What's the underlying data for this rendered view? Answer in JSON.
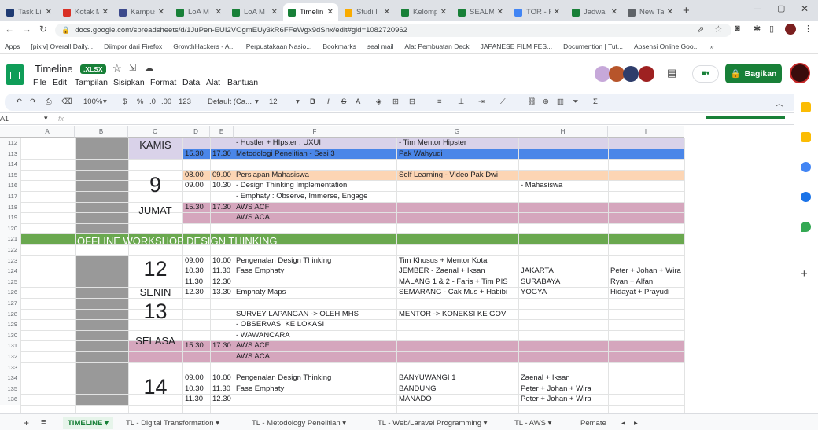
{
  "browser": {
    "tabs": [
      {
        "label": "Task Lis",
        "icon": "check-icon",
        "color": "#1f3b73"
      },
      {
        "label": "Kotak M",
        "icon": "gmail-icon",
        "color": "#d93025"
      },
      {
        "label": "Kampus",
        "icon": "doc-icon",
        "color": "#3c4a8c"
      },
      {
        "label": "LoA M",
        "icon": "drive-icon",
        "color": "#188038"
      },
      {
        "label": "LoA M",
        "icon": "sheets-icon",
        "color": "#188038"
      },
      {
        "label": "Timelin",
        "icon": "sheets-icon",
        "color": "#188038"
      },
      {
        "label": "Studi I",
        "icon": "drive-icon",
        "color": "#f9ab00"
      },
      {
        "label": "Kelomp",
        "icon": "sheets-icon",
        "color": "#188038"
      },
      {
        "label": "SEALM",
        "icon": "sheets-icon",
        "color": "#188038"
      },
      {
        "label": "TOR - F",
        "icon": "docs-icon",
        "color": "#4285f4"
      },
      {
        "label": "Jadwal",
        "icon": "sheets-icon",
        "color": "#188038"
      },
      {
        "label": "New Ta",
        "icon": "globe-icon",
        "color": "#5f6368"
      }
    ],
    "url": "docs.google.com/spreadsheets/d/1JuPen-EUI2VOgmEUy3kR6FFeWgx9dSnx/edit#gid=1082720962",
    "bookmarks": [
      "Apps",
      "[pixiv] Overall Daily...",
      "Diimpor dari Firefox",
      "GrowthHackers - A...",
      "Perpustakaan Nasio...",
      "Bookmarks",
      "seal mail",
      "Alat Pembuatan Deck",
      "JAPANESE FILM FES...",
      "Documention | Tut...",
      "Absensi Online Goo..."
    ]
  },
  "doc": {
    "title": "Timeline",
    "badge": ".XLSX",
    "share": "Bagikan",
    "menus": [
      "File",
      "Edit",
      "Tampilan",
      "Sisipkan",
      "Format",
      "Data",
      "Alat",
      "Bantuan"
    ]
  },
  "toolbar": {
    "zoom": "100%",
    "currency": "$",
    "percent": "%",
    "dec0": ".0",
    "dec00": ".00",
    "numfmt": "123",
    "font": "Default (Ca...",
    "size": "12",
    "bold": "B",
    "italic": "I",
    "strike": "S",
    "textcolor": "A"
  },
  "formula": {
    "ref": "A1",
    "fx": "fx"
  },
  "columns": [
    "A",
    "B",
    "C",
    "D",
    "E",
    "F",
    "G",
    "H",
    "I"
  ],
  "rows": [
    "112",
    "113",
    "114",
    "115",
    "116",
    "117",
    "118",
    "119",
    "120",
    "121",
    "122",
    "123",
    "124",
    "125",
    "126",
    "127",
    "128",
    "129",
    "130",
    "131",
    "132",
    "133",
    "134",
    "135",
    "136"
  ],
  "cells": {
    "kamis": "KAMIS",
    "d9": "9",
    "jumat": "JUMAT",
    "d12": "12",
    "senin": "SENIN",
    "d13": "13",
    "selasa": "SELASA",
    "d14": "14",
    "banner": "OFFLINE WORKSHOP DESIGN THINKING",
    "r112f": "- Hustler + HIpster : UXUI",
    "r112g": "- Tim Mentor Hipster",
    "r113d": "15.30",
    "r113e": "17.30",
    "r113f": "Metodologi Penelitian - Sesi 3",
    "r113g": "Pak Wahyudi",
    "r115d": "08.00",
    "r115e": "09.00",
    "r115f": "Persiapan Mahasiswa",
    "r115g": "Self Learning - Video Pak Dwi",
    "r116d": "09.00",
    "r116e": "10.30",
    "r116f": "- Design Thinking Implementation",
    "r116h": "- Mahasiswa",
    "r117f": "- Emphaty : Observe, Immerse, Engage",
    "r118d": "15.30",
    "r118e": "17.30",
    "r118f": "AWS ACF",
    "r119f": "AWS ACA",
    "r123d": "09.00",
    "r123e": "10.00",
    "r123f": "Pengenalan Design Thinking",
    "r123g": "Tim Khusus + Mentor Kota",
    "r124d": "10.30",
    "r124e": "11.30",
    "r124f": "Fase Emphaty",
    "r124g": "JEMBER  - Zaenal + Iksan",
    "r124h": "JAKARTA",
    "r124i": "Peter + Johan + Wira",
    "r125d": "11.30",
    "r125e": "12.30",
    "r125g": "MALANG 1 & 2 - Faris + Tim PIS",
    "r125h": "SURABAYA",
    "r125i": "Ryan + Alfan",
    "r126d": "12.30",
    "r126e": "13.30",
    "r126f": "Emphaty Maps",
    "r126g": "SEMARANG - Cak Mus + Habibi",
    "r126h": "YOGYA",
    "r126i": "Hidayat + Prayudi",
    "r128f": "SURVEY LAPANGAN -> OLEH MHS",
    "r128g": "MENTOR -> KONEKSI KE GOV",
    "r129f": "- OBSERVASI KE LOKASI",
    "r130f": "- WAWANCARA",
    "r131d": "15.30",
    "r131e": "17.30",
    "r131f": "AWS ACF",
    "r132f": "AWS ACA",
    "r134d": "09.00",
    "r134e": "10.00",
    "r134f": "Pengenalan Design Thinking",
    "r134g": "BANYUWANGI 1",
    "r134h": "Zaenal + Iksan",
    "r135d": "10.30",
    "r135e": "11.30",
    "r135f": "Fase Emphaty",
    "r135g": "BANDUNG",
    "r135h": "Peter + Johan + Wira",
    "r136d": "11.30",
    "r136e": "12.30",
    "r136g": "MANADO",
    "r136h": "Peter + Johan + Wira"
  },
  "sheets": [
    "TIMELINE",
    "TL - Digital Transformation",
    "TL - Metodology Penelitian",
    "TL - Web/Laravel Programming",
    "TL - AWS",
    "Pemate"
  ],
  "colors": {
    "purple": "#d9d2e9",
    "blue": "#4a86e8",
    "orange": "#fcd5b4",
    "pink": "#d5a6bd",
    "green": "#6aa84f",
    "gray": "#999999",
    "accent": "#188038"
  }
}
